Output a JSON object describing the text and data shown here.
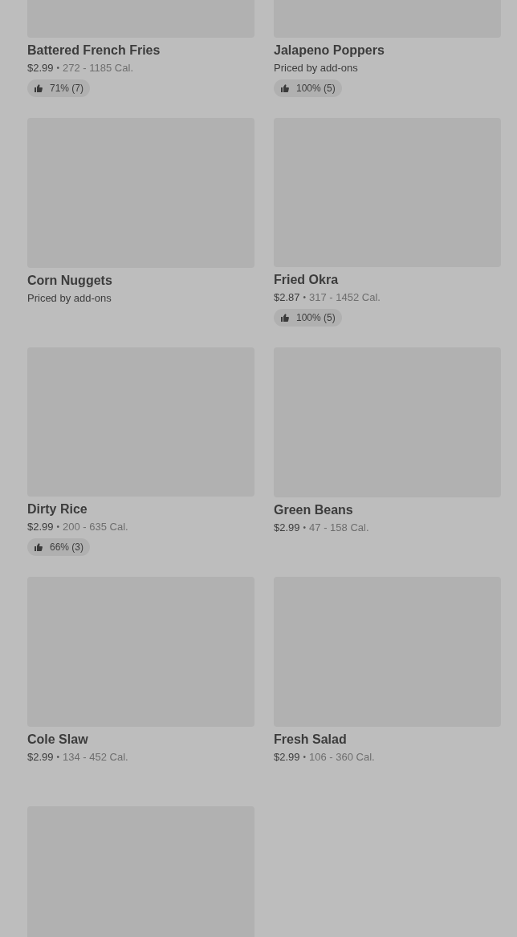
{
  "items": [
    {
      "kind": "dish",
      "name": "Battered French Fries",
      "price": "$2.99",
      "separator": "•",
      "calories": "272 - 1185 Cal.",
      "rating": "71% (7)"
    },
    {
      "kind": "dish",
      "name": "Jalapeno Poppers",
      "price_note": "Priced by add-ons",
      "rating": "100% (5)"
    },
    {
      "kind": "dish",
      "name": "Corn Nuggets",
      "price_note": "Priced by add-ons"
    },
    {
      "kind": "dish",
      "name": "Fried Okra",
      "price": "$2.87",
      "separator": "•",
      "calories": "317 - 1452 Cal.",
      "rating": "100% (5)"
    },
    {
      "kind": "dish",
      "name": "Dirty Rice",
      "price": "$2.99",
      "separator": "•",
      "calories": "200 - 635 Cal.",
      "rating": "66% (3)"
    },
    {
      "kind": "dish",
      "name": "Green Beans",
      "price": "$2.99",
      "separator": "•",
      "calories": "47 - 158 Cal."
    },
    {
      "kind": "dish",
      "name": "Cole Slaw",
      "price": "$2.99",
      "separator": "•",
      "calories": "134 - 452 Cal."
    },
    {
      "kind": "dish",
      "name": "Fresh Salad",
      "price": "$2.99",
      "separator": "•",
      "calories": "106 - 360 Cal."
    },
    {
      "kind": "image_only"
    }
  ]
}
